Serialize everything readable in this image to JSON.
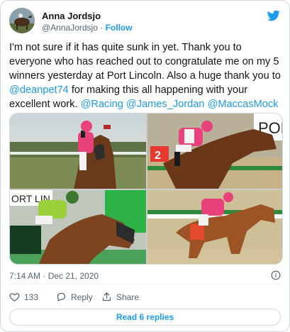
{
  "author": {
    "name": "Anna Jordsjo",
    "handle": "@AnnaJordsjo",
    "separator": "·",
    "follow_label": "Follow"
  },
  "tweet": {
    "text_parts": [
      "I'm not sure if it has quite sunk in yet. Thank you to everyone who has reached out to congratulate me on my 5 winners yesterday at Port Lincoln. Also a huge thank you to ",
      " for making this all happening with your excellent work. ",
      " ",
      " "
    ],
    "mentions": [
      "@deanpet74",
      "@Racing",
      "@James_Jordan",
      "@MaccasMock"
    ]
  },
  "media": {
    "photo_signs": [
      "POR",
      "ORT LIN"
    ]
  },
  "timestamp": "7:14 AM · Dec 21, 2020",
  "actions": {
    "like_count": "133",
    "reply_label": "Reply",
    "share_label": "Share"
  },
  "read_replies_label": "Read 6 replies",
  "colors": {
    "accent": "#1d9bf0",
    "like_red": "#f91880",
    "text_secondary": "#536471"
  },
  "icons": [
    "twitter-bird-icon",
    "info-icon",
    "heart-icon",
    "reply-icon",
    "share-icon"
  ]
}
